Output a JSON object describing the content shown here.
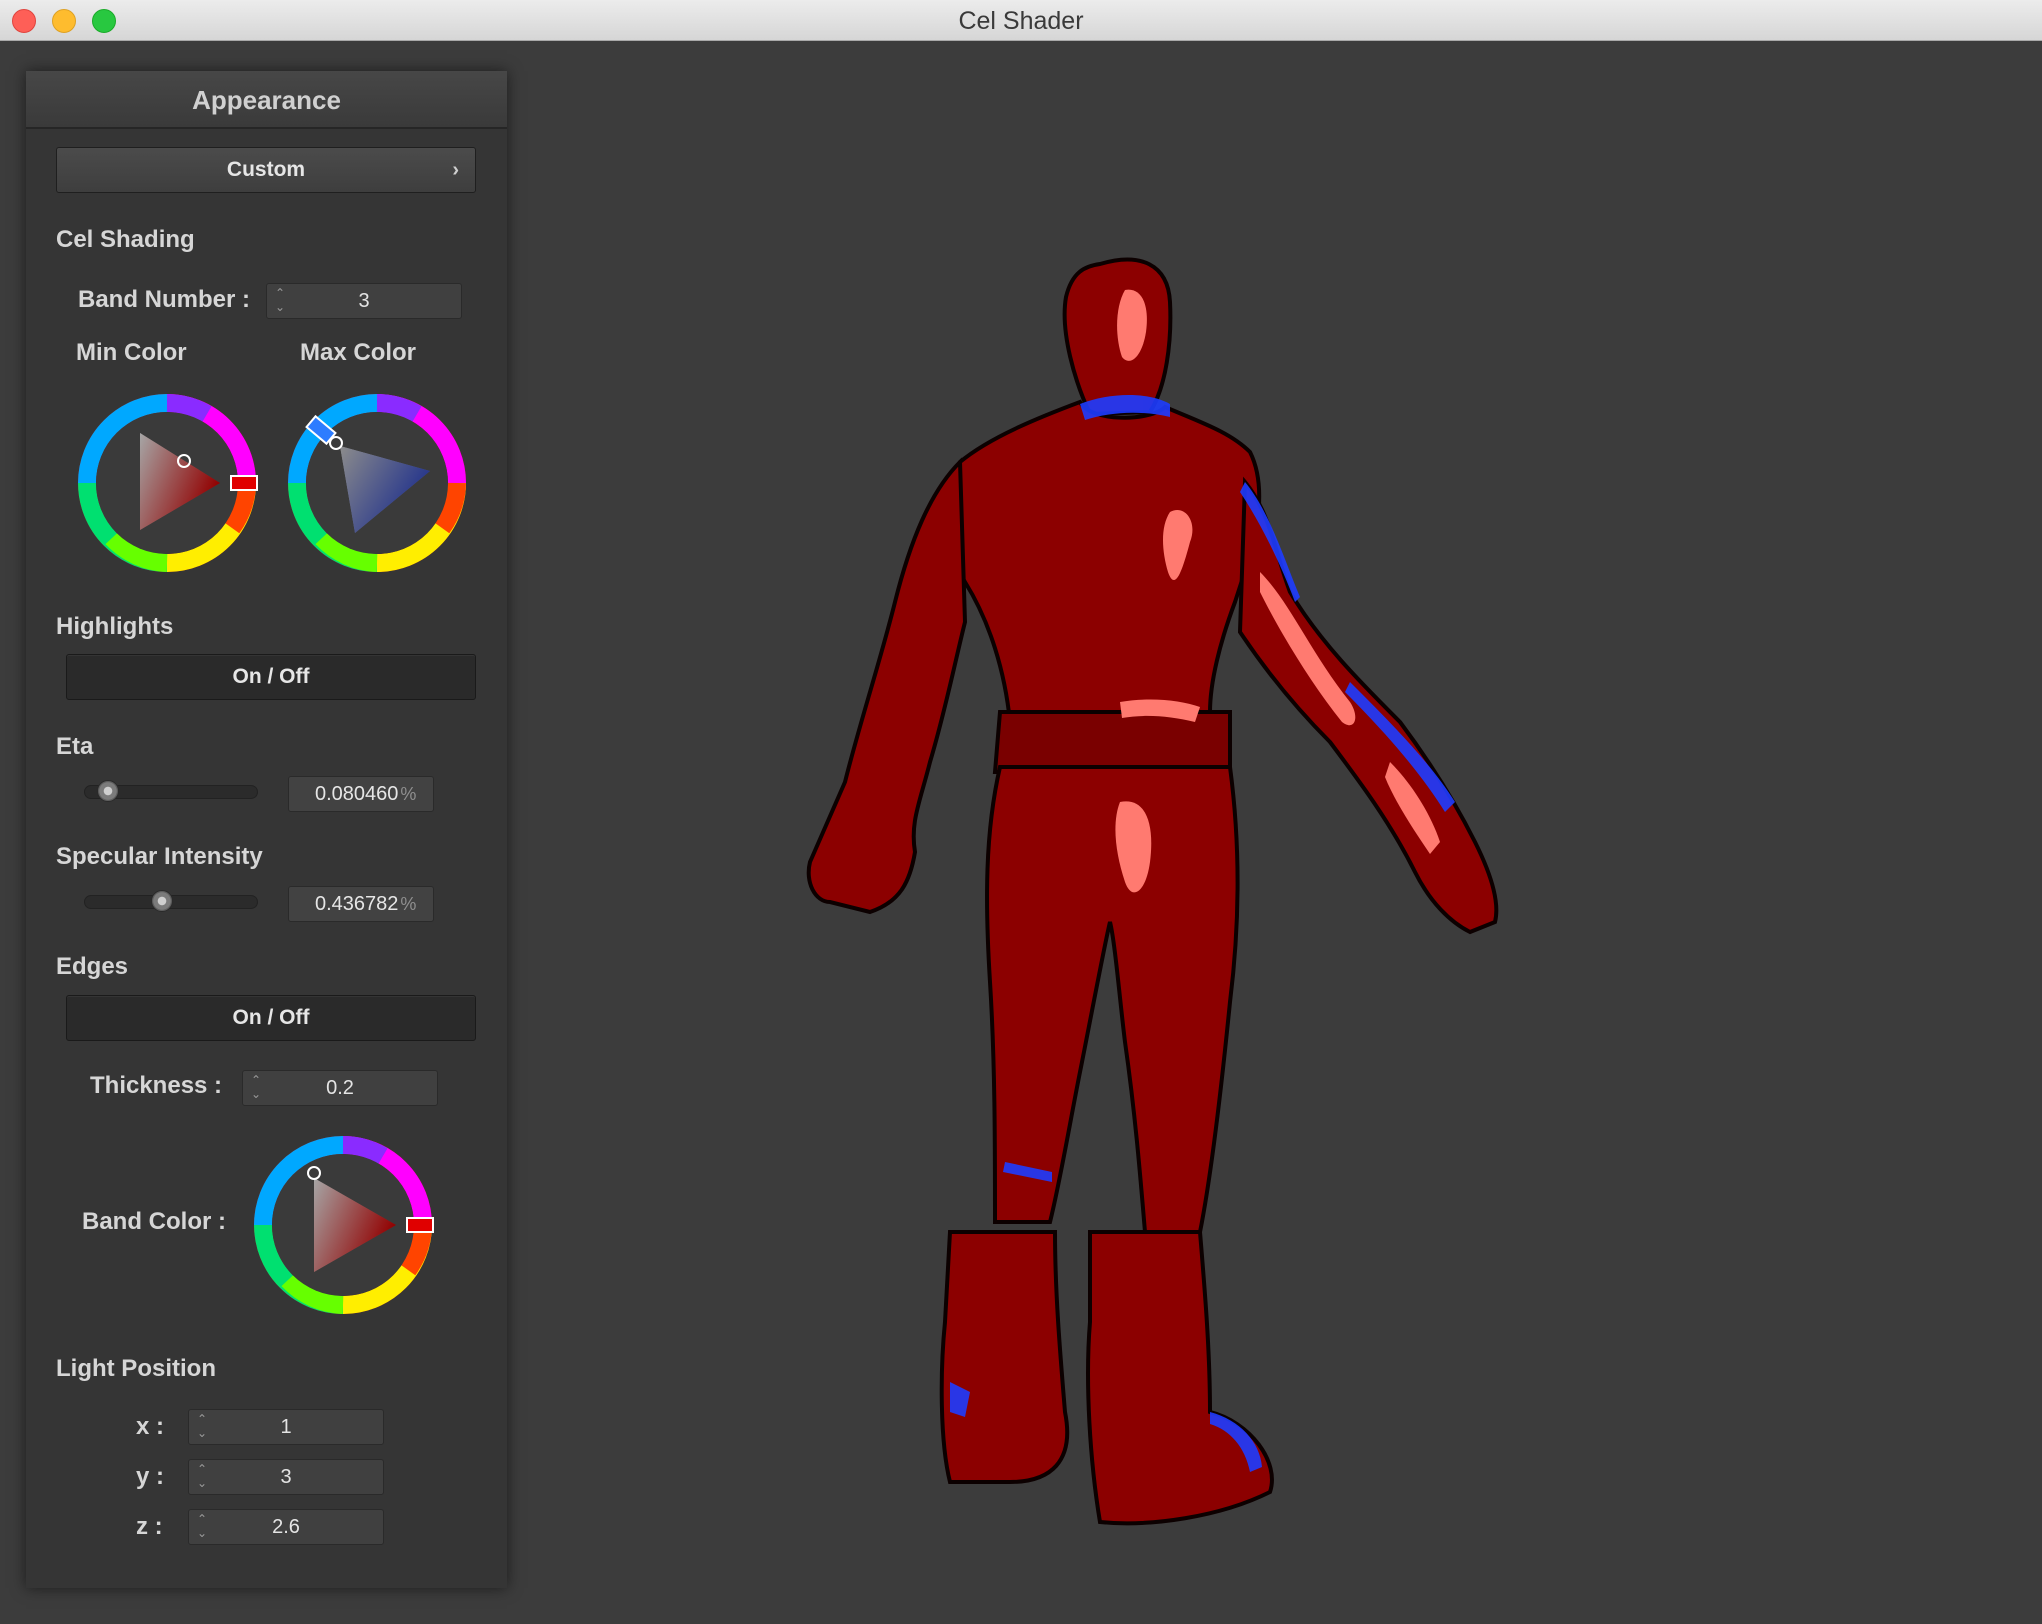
{
  "window": {
    "title": "Cel Shader"
  },
  "panel": {
    "title": "Appearance",
    "preset": {
      "label": "Custom",
      "chevron": "›"
    },
    "cel_shading": {
      "heading": "Cel Shading",
      "band_number": {
        "label": "Band Number :",
        "value": "3"
      },
      "min_color": {
        "label": "Min Color",
        "color": "#d01b1b"
      },
      "max_color": {
        "label": "Max Color",
        "color": "#2f4fd8"
      }
    },
    "highlights": {
      "heading": "Highlights",
      "toggle_label": "On / Off",
      "eta": {
        "label": "Eta",
        "value": "0.080460",
        "unit": "%",
        "fraction": 0.08046
      },
      "specular": {
        "label": "Specular Intensity",
        "value": "0.436782",
        "unit": "%",
        "fraction": 0.436782
      }
    },
    "edges": {
      "heading": "Edges",
      "toggle_label": "On / Off",
      "thickness": {
        "label": "Thickness :",
        "value": "0.2"
      },
      "band_color": {
        "label": "Band Color :",
        "color": "#d01b1b"
      }
    },
    "light_position": {
      "heading": "Light Position",
      "x": {
        "label": "x :",
        "value": "1"
      },
      "y": {
        "label": "y :",
        "value": "3"
      },
      "z": {
        "label": "z :",
        "value": "2.6"
      }
    }
  },
  "icons": {
    "spinner": "spin-arrows-icon"
  }
}
